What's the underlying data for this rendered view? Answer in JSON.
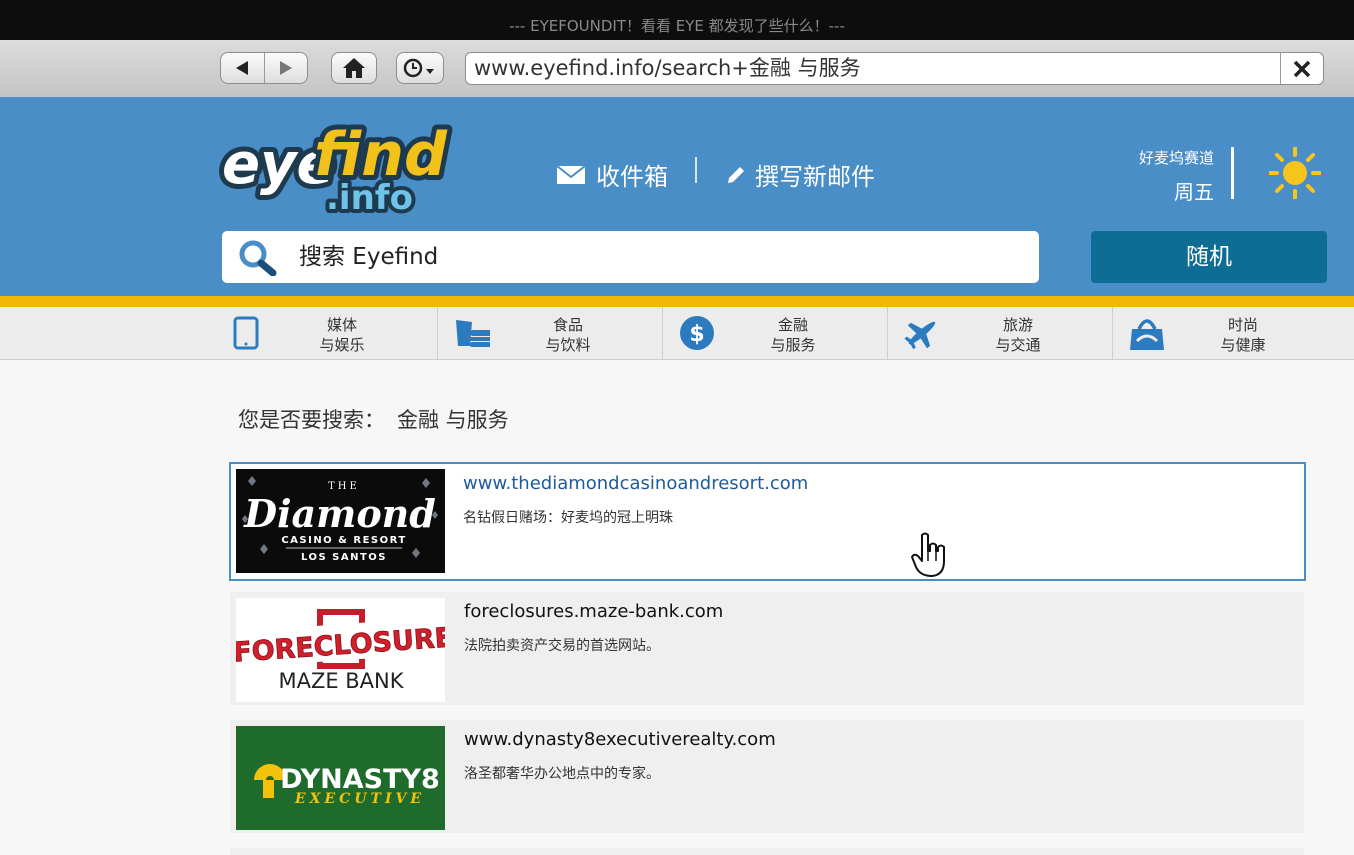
{
  "window": {
    "title": "--- EYEFOUNDIT！看看 EYE 都发现了些什么！---"
  },
  "browser": {
    "back_icon": "triangle-left-icon",
    "forward_icon": "triangle-right-icon",
    "home_icon": "home-icon",
    "history_icon": "clock-dropdown-icon",
    "url": "www.eyefind.info/search+金融 与服务",
    "close_icon": "x-icon"
  },
  "header": {
    "logo_text_main": "eyefind",
    "logo_text_sub": ".info",
    "inbox_label": "收件箱",
    "compose_label": "撰写新邮件",
    "weather_location": "好麦坞赛道",
    "weather_day": "周五",
    "weather_icon": "sun-icon",
    "colors": {
      "header_bg": "#4a8ec7",
      "accent_gold": "#f2b705",
      "button_teal": "#0e6d95"
    }
  },
  "search": {
    "placeholder": "搜索 Eyefind",
    "random_label": "随机"
  },
  "categories": [
    {
      "line1": "媒体",
      "line2": "与娱乐",
      "icon": "tablet-icon"
    },
    {
      "line1": "食品",
      "line2": "与饮料",
      "icon": "food-icon"
    },
    {
      "line1": "金融",
      "line2": "与服务",
      "icon": "dollar-coin-icon"
    },
    {
      "line1": "旅游",
      "line2": "与交通",
      "icon": "airplane-icon"
    },
    {
      "line1": "时尚",
      "line2": "与健康",
      "icon": "shopping-bag-icon"
    }
  ],
  "did_you_mean": {
    "prefix": "您是否要搜索：",
    "query": "金融 与服务"
  },
  "results": [
    {
      "url": "www.thediamondcasinoandresort.com",
      "desc": "名钻假日赌场：好麦坞的冠上明珠",
      "thumb_the": "THE",
      "thumb_main": "Diamond",
      "thumb_sub1": "CASINO & RESORT",
      "thumb_sub2": "LOS SANTOS"
    },
    {
      "url": "foreclosures.maze-bank.com",
      "desc": "法院拍卖资产交易的首选网站。",
      "thumb_main": "FORECLOSURE",
      "thumb_sub1": "MAZE BANK"
    },
    {
      "url": "www.dynasty8executiverealty.com",
      "desc": "洛圣都奢华办公地点中的专家。",
      "thumb_main": "DYNASTY8",
      "thumb_sub1": "EXECUTIVE"
    }
  ],
  "cursor_icon": "hand-pointer-icon"
}
